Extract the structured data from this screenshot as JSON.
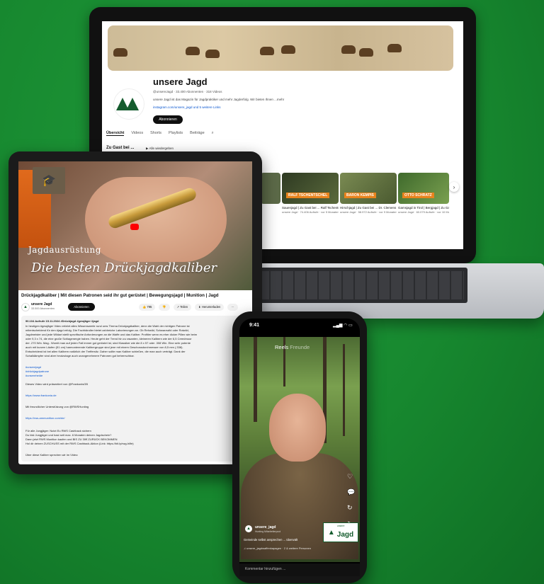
{
  "colors": {
    "background": "#17882f",
    "brand_green": "#155c2e",
    "accent_orange": "#e8831d",
    "yt_red": "#ff0000"
  },
  "laptop": {
    "channel_name": "unsere Jagd",
    "channel_meta": "@unsereJagd · 33.400 Abonnenten · 318 Videos",
    "channel_desc": "unsere Jagd ist das Magazin für Jagdpraktiker und mehr Jagderfolg. Wir bieten Ihnen ...mehr",
    "channel_link": "instagram.com/unsere_jagd und 5 weitere Links",
    "subscribe_label": "Abonnieren",
    "tabs": [
      "Übersicht",
      "Videos",
      "Shorts",
      "Playlists",
      "Beiträge"
    ],
    "search_icon": "search-icon",
    "shelf_title": "Zu Gast bei ...",
    "play_all": "▶ Alle wiedergeben",
    "videos": [
      {
        "tag": "",
        "title": "",
        "stats": "",
        "thumb": "#5c6a48"
      },
      {
        "tag": "RALF TSCHENTSCHEL",
        "title": "Sauenjagd | Zu Gast bei ... Ralf Tschentschel |",
        "stats": "unsere Jagd · 74.406 Aufrufe · vor 5 Monaten",
        "thumb": "#3f4a2c"
      },
      {
        "tag": "BARON KEMPIS",
        "title": "Hirschjagd | Zu Gast bei ... Dr. Clemens Ritter von Kempis",
        "stats": "unsere Jagd · 58.972 Aufrufe · vor 9 Monaten",
        "thumb": "#6a7a42"
      },
      {
        "tag": "OTTO SCHRATZ",
        "title": "Gamsjagd in Tirol | Bergjagd | Zu Gast bei Otto Schratz",
        "stats": "unsere Jagd · 60.079 Aufrufe · vor 10 Monaten",
        "thumb": "#4d6b35"
      }
    ]
  },
  "tablet": {
    "hero_subtitle": "Jagdausrüstung",
    "hero_title": "Die besten Drückjagdkaliber",
    "video_title": "Drückjagdkaliber | Mit diesen Patronen seid ihr gut gerüstet | Bewegungsjagd | Munition | Jagd",
    "channel_name": "unsere Jagd",
    "channel_subs": "33.500 Abonnenten",
    "subscribe_label": "Abonnieren",
    "actions": [
      "👍 795",
      "👎",
      "↗ Teilen",
      "⬇ Herunterladen",
      "···"
    ],
    "desc_stats": "90.104 Aufrufe  15.11.2024  #Drückjagd #gewjäger #jagd",
    "desc_lines": [
      "In heutigen #gewjäger Video erfahrt alles Wissenswerte rund ums Thema Drückjagdkaliber, denn die Wahl der richtigen Patrone ist",
      "mitentscheidend für den #jagd erfolg. Die Fachhändler bietet zahlreiche Laborierungen an. Ob Rehwild, Schwarzwild oder Rotwild,",
      "Jagdmeister und jede Wildart stellt spezifische Anforderungen an die Waffe und das Kaliber. Profitier wenn es eher dicker Pillen wie beim",
      "oder 9,3 x 74, die eine große Schlagenergie haben. Heute geht der Trend hin zu rasanten, kleineren Kalibern wie der 6,5 Creedmoor",
      "der .270 Win. Mag.. Womit man auf jeden Fall immer gut gerüstet ist, sind Klassiker wie die 8 x 57 oder .308 Win. Eine sehr potente",
      "auch mit kurzen Läufen (51 cm) harmonierende Kalibergruppe sind jene mit einem Geschossdurchmesser von 8,5 mm (.338).",
      "Entscheidend ist bei allen Kalibern natürlich der Treffersitz. Daher sollte man Kaliber schießen, die man auch verträgt. Dank der",
      "Schalldämpfer sind aber heutzutage auch unangenehmere Patronen gut beherrschbar."
    ],
    "hashtags": [
      "#unserejagd",
      "#drückjagdpatrone",
      "#unserehelde"
    ],
    "presented_by": "Dieses Video wird präsentiert von @FrankonisGB",
    "link1": "https://www.frankonia.de",
    "support": "Mit freundlicher Unterstützung von @RWSHunting",
    "link2": "https://rws-ammunition.com/de/",
    "promo_lines": [
      "Für alle Jungjäger: Nutzt Eu RWS Cashback sichern",
      "Du bist Jungjäger und hast seit max. 6 Monaten deinen Jagdschein?",
      "Dann jetzt RWS Munition kaufen und BIS ZU 30€ ZURÜCK BEKOMMEN",
      "Hol dir deinen ZUSCHUSS mit der RWS Cashback-Aktion (Link: https://bit.ly/rwg-hilfe)"
    ],
    "footer_line": "Über diese Kaliber sprechen wir im Video:"
  },
  "phone": {
    "time": "9:41",
    "status": "▂▄▆ ◠ ▭",
    "reels_label": "Reels",
    "friends_label": "Freunde",
    "side_icons": [
      "♡",
      "💬",
      "↻",
      "➤"
    ],
    "user": "unsere_jagd",
    "user_sub": "Hunting Mitarbeiterpool",
    "caption": "Gemeinde selbst ansprechen ... überwält",
    "audio": "♫ unsere_jagdwaffenkapagen · 2 & weitere Personen",
    "brand_top": "unsere",
    "brand_label": "Jagd",
    "comment_placeholder": "Kommentar hinzufügen ..."
  }
}
